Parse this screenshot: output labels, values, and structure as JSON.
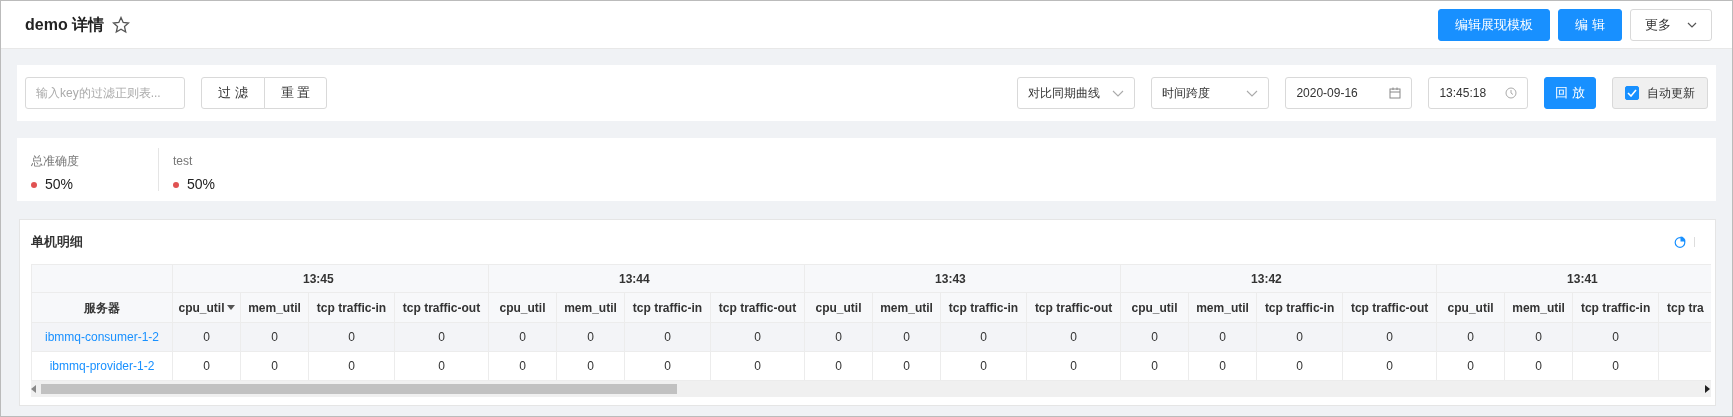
{
  "header": {
    "title": "demo 详情",
    "favorite": false,
    "buttons": [
      {
        "label": "编辑展现模板",
        "kind": "primary"
      },
      {
        "label": "编 辑",
        "kind": "primary"
      },
      {
        "label": "更多",
        "kind": "dropdown"
      }
    ]
  },
  "filter": {
    "placeholder": "输入key的过滤正则表...",
    "buttons": [
      "过 滤",
      "重 置"
    ],
    "selects": [
      {
        "value": "对比同期曲线"
      },
      {
        "value": "时间跨度"
      }
    ],
    "date": {
      "value": "2020-09-16"
    },
    "time": {
      "value": "13:45:18"
    },
    "replay": "回 放",
    "auto_update": {
      "label": "自动更新",
      "checked": true
    }
  },
  "stats": [
    {
      "label": "总准确度",
      "value": "50%",
      "color": "#e05252"
    },
    {
      "label": "test",
      "value": "50%",
      "color": "#e05252"
    }
  ],
  "detail": {
    "title": "单机明细",
    "table": {
      "server_header": "服务器",
      "groups": [
        {
          "time": "13:45",
          "columns": [
            {
              "label": "cpu_util",
              "sorted": true
            },
            {
              "label": "mem_util"
            },
            {
              "label": "tcp traffic-in"
            },
            {
              "label": "tcp traffic-out"
            }
          ]
        },
        {
          "time": "13:44",
          "columns": [
            {
              "label": "cpu_util"
            },
            {
              "label": "mem_util"
            },
            {
              "label": "tcp traffic-in"
            },
            {
              "label": "tcp traffic-out"
            }
          ]
        },
        {
          "time": "13:43",
          "columns": [
            {
              "label": "cpu_util"
            },
            {
              "label": "mem_util"
            },
            {
              "label": "tcp traffic-in"
            },
            {
              "label": "tcp traffic-out"
            }
          ]
        },
        {
          "time": "13:42",
          "columns": [
            {
              "label": "cpu_util"
            },
            {
              "label": "mem_util"
            },
            {
              "label": "tcp traffic-in"
            },
            {
              "label": "tcp traffic-out"
            }
          ]
        },
        {
          "time": "13:41",
          "columns": [
            {
              "label": "cpu_util"
            },
            {
              "label": "mem_util"
            },
            {
              "label": "tcp traffic-in"
            },
            {
              "label": "tcp tra"
            }
          ]
        }
      ],
      "rows": [
        {
          "server": "ibmmq-consumer-1-2",
          "hovered": true,
          "values": [
            "0",
            "0",
            "0",
            "0",
            "0",
            "0",
            "0",
            "0",
            "0",
            "0",
            "0",
            "0",
            "0",
            "0",
            "0",
            "0",
            "0",
            "0",
            "0"
          ]
        },
        {
          "server": "ibmmq-provider-1-2",
          "hovered": false,
          "values": [
            "0",
            "0",
            "0",
            "0",
            "0",
            "0",
            "0",
            "0",
            "0",
            "0",
            "0",
            "0",
            "0",
            "0",
            "0",
            "0",
            "0",
            "0",
            "0"
          ]
        }
      ]
    }
  }
}
